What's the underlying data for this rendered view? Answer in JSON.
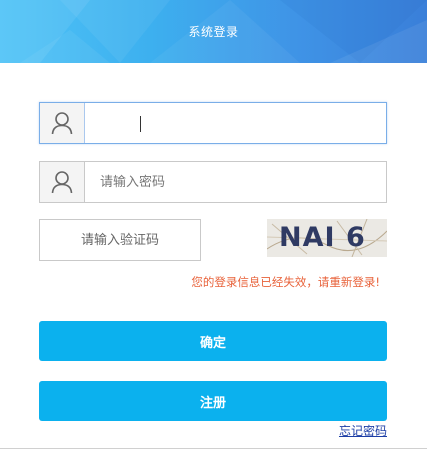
{
  "header": {
    "title": "系统登录",
    "colors": {
      "start": "#4fc3f7",
      "end": "#3a7fd9"
    }
  },
  "form": {
    "username": {
      "value": "",
      "placeholder": "",
      "icon": "user-icon",
      "focused": true
    },
    "password": {
      "value": "",
      "placeholder": "请输入密码",
      "icon": "user-icon"
    },
    "captcha": {
      "value": "",
      "placeholder": "请输入验证码",
      "image_text": "NAI 6"
    },
    "error_message": "您的登录信息已经失效，请重新登录!",
    "submit_label": "确定",
    "register_label": "注册",
    "forgot_label": "忘记密码"
  },
  "colors": {
    "button": "#0bb1ee",
    "error": "#e8623a",
    "link": "#1d3ea6",
    "focus_border": "#7aaee8"
  }
}
